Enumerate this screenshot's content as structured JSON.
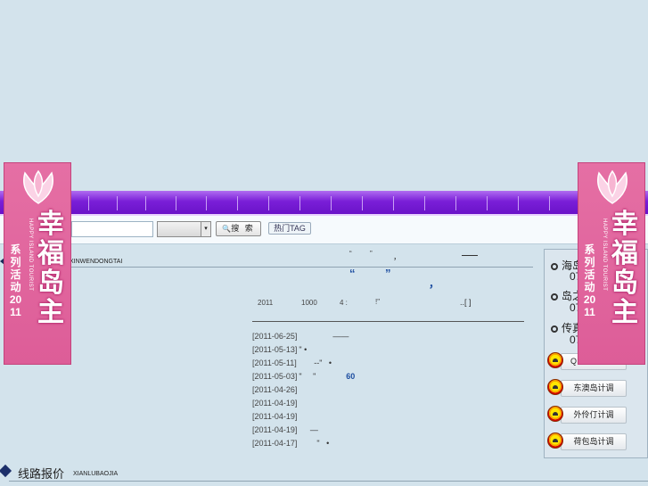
{
  "search": {
    "category_arrow": "▾",
    "search_label": "搜 索",
    "hot_tag_label": "热门TAG"
  },
  "news": {
    "section_sub": "XINWENDONGTAI",
    "headline": {
      "q_open": "“",
      "q_close": "”",
      "comma": "，",
      "big_q_open": "“",
      "big_q_close": "”",
      "big_comma": "，"
    },
    "summary": {
      "year": "2011",
      "num": "1000",
      "four": "4 :",
      "excl": "!\"",
      "more": "..[ ]"
    },
    "items": [
      {
        "date": "[2011-06-25]",
        "title": "——",
        "bold": ""
      },
      {
        "date": "[2011-05-13]",
        "title": "\"  •",
        "bold": ""
      },
      {
        "date": "[2011-05-11]",
        "title": "       --\"   •",
        "bold": ""
      },
      {
        "date": "[2011-05-03]",
        "title": "\"     \"",
        "bold": "60"
      },
      {
        "date": "[2011-04-26]",
        "title": "",
        "bold": ""
      },
      {
        "date": "[2011-04-19]",
        "title": "",
        "bold": ""
      },
      {
        "date": "[2011-04-19]",
        "title": "",
        "bold": ""
      },
      {
        "date": "[2011-04-19]",
        "title": "     —",
        "bold": ""
      },
      {
        "date": "[2011-04-17]",
        "title": "        \"   •",
        "bold": ""
      }
    ]
  },
  "right_panel": {
    "rows": [
      {
        "title": "海岛",
        "num": "07"
      },
      {
        "title": "岛之",
        "num": "07"
      },
      {
        "title": "传真",
        "num": "07"
      }
    ],
    "buttons": [
      {
        "label": "Q"
      },
      {
        "label": "东澳岛计调"
      },
      {
        "label": "外伶仃计调"
      },
      {
        "label": "荷包岛计调"
      }
    ]
  },
  "route": {
    "title": "线路报价",
    "sub": "XIANLUBAOJIA"
  },
  "banner": {
    "big": "幸福岛主",
    "series": "系列活动2011",
    "english": "HAPPY ISLAND TOURIST"
  },
  "colors": {
    "nav_purple": "#7a1fd8",
    "banner_pink": "#e56fa4",
    "link_blue": "#1e4ea0",
    "page_bg": "#d3e3ec"
  }
}
